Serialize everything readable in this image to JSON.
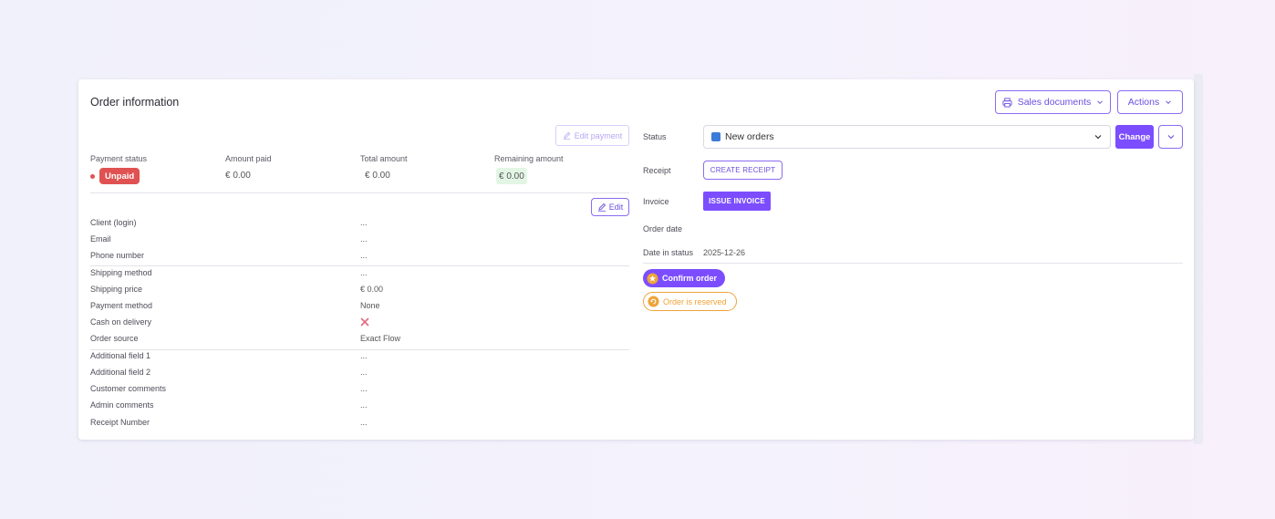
{
  "panel": {
    "title": "Order information",
    "sales_documents_label": "Sales documents",
    "actions_label": "Actions"
  },
  "payment": {
    "edit_payment_label": "Edit payment",
    "columns": {
      "status": "Payment status",
      "paid": "Amount paid",
      "total": "Total amount",
      "remaining": "Remaining amount"
    },
    "values": {
      "status": "Unpaid",
      "paid": "€ 0.00",
      "total": "€ 0.00",
      "remaining": "€ 0.00"
    },
    "status_color": "#e05252"
  },
  "details": {
    "edit_label": "Edit",
    "fields": [
      {
        "label": "Client (login)",
        "value": "..."
      },
      {
        "label": "Email",
        "value": "..."
      },
      {
        "label": "Phone number",
        "value": "..."
      },
      {
        "label": "Shipping method",
        "value": "..."
      },
      {
        "label": "Shipping price",
        "value": "€ 0.00"
      },
      {
        "label": "Payment method",
        "value": "None"
      },
      {
        "label": "Cash on delivery",
        "value": "",
        "icon": "cross-icon"
      },
      {
        "label": "Order source",
        "value": "Exact Flow"
      },
      {
        "label": "Additional field 1",
        "value": "..."
      },
      {
        "label": "Additional field 2",
        "value": "..."
      },
      {
        "label": "Customer comments",
        "value": "..."
      },
      {
        "label": "Admin comments",
        "value": "..."
      },
      {
        "label": "Receipt Number",
        "value": "..."
      }
    ]
  },
  "order_status": {
    "status_label": "Status",
    "status_value": "New orders",
    "status_color": "#3d7bd9",
    "change_label": "Change",
    "receipt_label": "Receipt",
    "create_receipt_label": "CREATE RECEIPT",
    "invoice_label": "Invoice",
    "issue_invoice_label": "ISSUE INVOICE",
    "order_date_label": "Order date",
    "order_date_value": "",
    "date_in_status_label": "Date in status",
    "date_in_status_value": "2025-12-26",
    "confirm_order_label": "Confirm order",
    "reserved_label": "Order is reserved"
  },
  "colors": {
    "accent": "#7c4dff",
    "reserved": "#f0a33a",
    "remaining_bg": "#e3f6e6"
  }
}
